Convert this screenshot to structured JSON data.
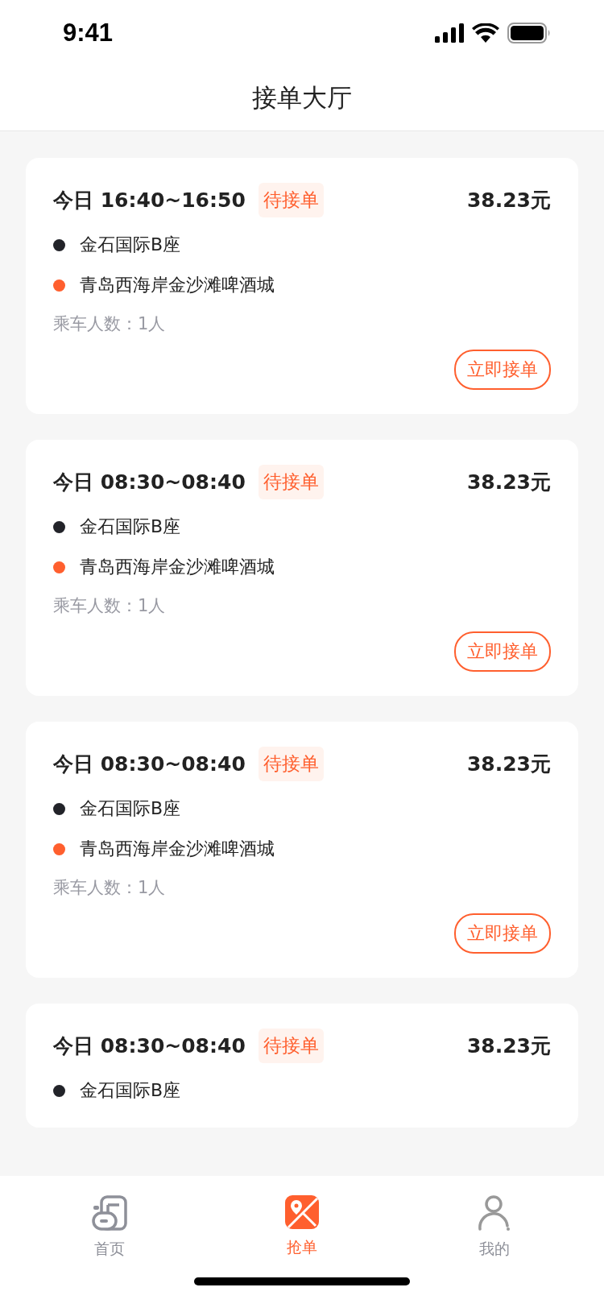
{
  "status_bar": {
    "time": "9:41"
  },
  "nav": {
    "title": "接单大厅"
  },
  "orders": [
    {
      "time": "今日 16:40~16:50",
      "status": "待接单",
      "price": "38.23元",
      "stops": [
        {
          "name": "金石国际B座",
          "kind": "start"
        },
        {
          "name": "青岛西海岸金沙滩啤酒城",
          "kind": "end"
        }
      ],
      "passengers": "乘车人数：1人",
      "action": "立即接单"
    },
    {
      "time": "今日 08:30~08:40",
      "status": "待接单",
      "price": "38.23元",
      "stops": [
        {
          "name": "金石国际B座",
          "kind": "start"
        },
        {
          "name": "青岛西海岸金沙滩啤酒城",
          "kind": "end"
        }
      ],
      "passengers": "乘车人数：1人",
      "action": "立即接单"
    },
    {
      "time": "今日 08:30~08:40",
      "status": "待接单",
      "price": "38.23元",
      "stops": [
        {
          "name": "金石国际B座",
          "kind": "start"
        },
        {
          "name": "青岛西海岸金沙滩啤酒城",
          "kind": "end"
        }
      ],
      "passengers": "乘车人数：1人",
      "action": "立即接单"
    },
    {
      "time": "今日 08:30~08:40",
      "status": "待接单",
      "price": "38.23元",
      "stops": [
        {
          "name": "金石国际B座",
          "kind": "start"
        }
      ]
    }
  ],
  "tab_bar": [
    {
      "label": "首页",
      "kind": "home",
      "selected": false
    },
    {
      "label": "抢单",
      "kind": "grab",
      "selected": true
    },
    {
      "label": "我的",
      "kind": "me",
      "selected": false
    }
  ]
}
